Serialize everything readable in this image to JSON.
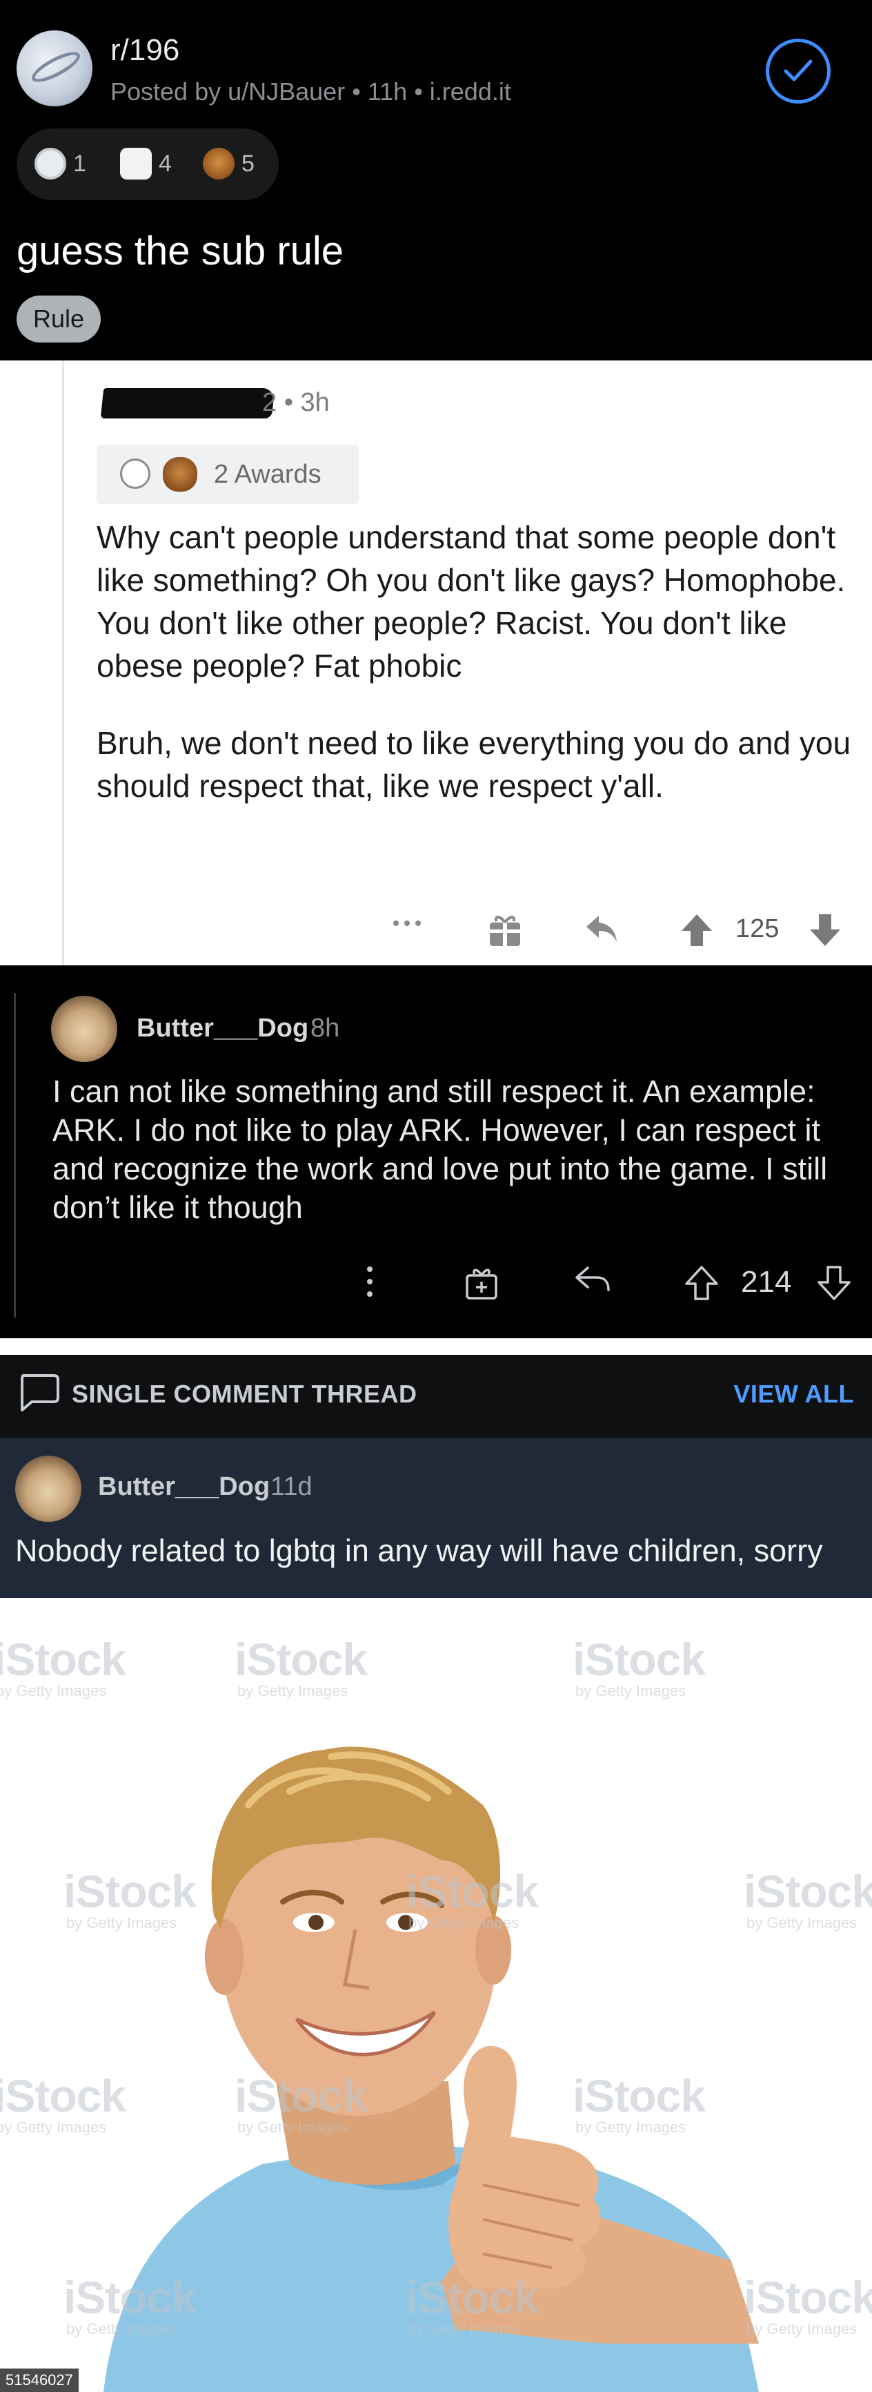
{
  "post": {
    "subreddit": "r/196",
    "meta": "Posted by u/NJBauer • 11h • i.redd.it",
    "title": "guess the sub rule",
    "flair": "Rule",
    "awards": [
      {
        "icon": "silver-award-icon",
        "count": "1"
      },
      {
        "icon": "helpful-award-icon",
        "count": "4"
      },
      {
        "icon": "bear-award-icon",
        "count": "5"
      }
    ],
    "colors": {
      "accent": "#3d8dff",
      "flair_bg": "#aeb3b7"
    }
  },
  "comment_light": {
    "meta": "2 • 3h",
    "awards_label": "2 Awards",
    "paragraph_1": "Why can't people understand that some people don't like something? Oh you don't like gays? Homophobe. You don't like other people? Racist. You don't like obese people? Fat phobic",
    "paragraph_2": "Bruh, we don't need to like everything you do and you should respect that, like we respect y'all.",
    "score": "125"
  },
  "comment_dark": {
    "author": "Butter___Dog",
    "age": "8h",
    "body": "I can not like something and still respect it. An example: ARK. I do not like to play ARK. However, I can respect it and recognize the work and love put into the game. I still don’t like it though",
    "score": "214"
  },
  "thread": {
    "label": "SINGLE COMMENT THREAD",
    "view_all": "VIEW ALL",
    "author": "Butter___Dog",
    "age": "11d",
    "body": "Nobody related to lgbtq in any way will have children, sorry"
  },
  "photo": {
    "watermark_brand": "iStock",
    "watermark_sub": "by Getty Images",
    "stock_id": "51546027"
  }
}
